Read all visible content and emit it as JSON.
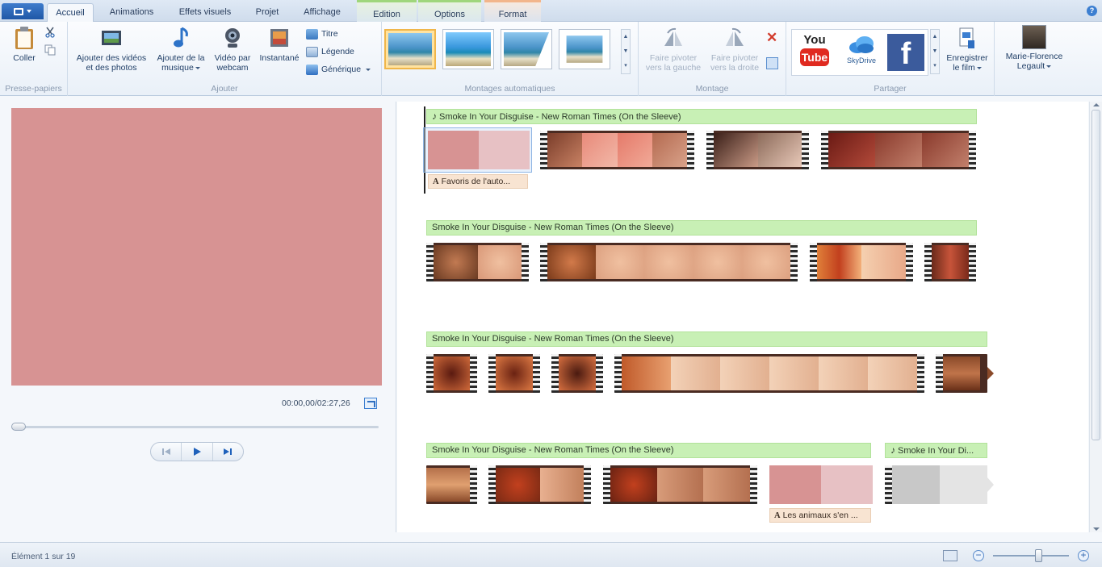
{
  "tabs": {
    "home": "Accueil",
    "animations": "Animations",
    "visual_effects": "Effets visuels",
    "project": "Projet",
    "view": "Affichage",
    "edit": "Edition",
    "options": "Options",
    "format": "Format"
  },
  "ribbon": {
    "clipboard": {
      "label": "Presse-papiers",
      "paste": "Coller"
    },
    "add": {
      "label": "Ajouter",
      "add_videos": "Ajouter des vidéos",
      "add_videos_2": "et des photos",
      "add_music": "Ajouter de la",
      "add_music_2": "musique",
      "webcam": "Vidéo par",
      "webcam_2": "webcam",
      "snapshot": "Instantané",
      "title": "Titre",
      "caption": "Légende",
      "credits": "Générique"
    },
    "automovies": {
      "label": "Montages automatiques"
    },
    "editing": {
      "label": "Montage",
      "rotate_left": "Faire pivoter",
      "rotate_left_2": "vers la gauche",
      "rotate_right": "Faire pivoter",
      "rotate_right_2": "vers la droite"
    },
    "share": {
      "label": "Partager",
      "youtube_top": "You",
      "youtube_bottom": "Tube",
      "skydrive": "SkyDrive",
      "facebook": "f",
      "save_movie": "Enregistrer",
      "save_movie_2": "le film"
    },
    "user": {
      "name": "Marie-Florence",
      "name_2": "Legault"
    }
  },
  "preview": {
    "timecode": "00:00,00/02:27,26",
    "seek_fraction": 0.0
  },
  "storyboard": {
    "music_title": "Smoke In Your Disguise - New Roman Times (On the Sleeve)",
    "music_title_short": "Smoke In Your Di...",
    "caption_1": "Favoris de l'auto...",
    "caption_2": "Les animaux s'en ..."
  },
  "status": {
    "item_text": "Élément 1 sur 19",
    "zoom_fraction": 0.6
  },
  "colors": {
    "accent": "#3c7fd1",
    "music_bar": "#c8f0b5",
    "caption_bg": "#f8e4d2",
    "preview_bg": "#d79393"
  }
}
